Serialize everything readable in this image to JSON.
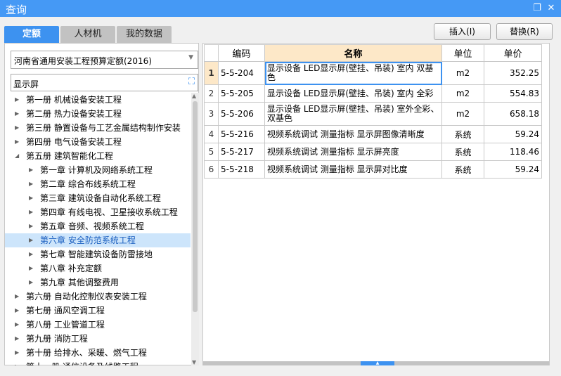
{
  "window": {
    "title": "查询",
    "restore_icon": "restore-icon",
    "close_icon": "close-icon"
  },
  "tabs": [
    {
      "label": "定额",
      "active": true
    },
    {
      "label": "人材机"
    },
    {
      "label": "我的数据"
    }
  ],
  "buttons": {
    "insert": "插入(I)",
    "replace": "替换(R)"
  },
  "quota_select": {
    "value": "河南省通用安装工程预算定额(2016)"
  },
  "search": {
    "value": "显示屏"
  },
  "tree": [
    {
      "label": "第一册  机械设备安装工程",
      "level": 0,
      "expanded": false
    },
    {
      "label": "第二册  热力设备安装工程",
      "level": 0,
      "expanded": false
    },
    {
      "label": "第三册  静置设备与工艺金属结构制作安装",
      "level": 0,
      "expanded": false
    },
    {
      "label": "第四册  电气设备安装工程",
      "level": 0,
      "expanded": false
    },
    {
      "label": "第五册  建筑智能化工程",
      "level": 0,
      "expanded": true
    },
    {
      "label": "第一章  计算机及网络系统工程",
      "level": 1
    },
    {
      "label": "第二章  综合布线系统工程",
      "level": 1
    },
    {
      "label": "第三章  建筑设备自动化系统工程",
      "level": 1
    },
    {
      "label": "第四章  有线电视、卫星接收系统工程",
      "level": 1
    },
    {
      "label": "第五章  音频、视频系统工程",
      "level": 1
    },
    {
      "label": "第六章  安全防范系统工程",
      "level": 1,
      "selected": true
    },
    {
      "label": "第七章  智能建筑设备防雷接地",
      "level": 1
    },
    {
      "label": "第八章  补充定额",
      "level": 1
    },
    {
      "label": "第九章  其他调整费用",
      "level": 1
    },
    {
      "label": "第六册  自动化控制仪表安装工程",
      "level": 0
    },
    {
      "label": "第七册  通风空调工程",
      "level": 0
    },
    {
      "label": "第八册  工业管道工程",
      "level": 0
    },
    {
      "label": "第九册  消防工程",
      "level": 0
    },
    {
      "label": "第十册  给排水、采暖、燃气工程",
      "level": 0
    },
    {
      "label": "第十一册  通信设备及线路工程",
      "level": 0
    }
  ],
  "table": {
    "headers": [
      "",
      "编码",
      "名称",
      "单位",
      "单价"
    ],
    "rows": [
      {
        "no": "1",
        "code": "5-5-204",
        "name": "显示设备 LED显示屏(壁挂、吊装) 室内 双基色",
        "unit": "m2",
        "price": "352.25",
        "selected": true
      },
      {
        "no": "2",
        "code": "5-5-205",
        "name": "显示设备 LED显示屏(壁挂、吊装) 室内 全彩",
        "unit": "m2",
        "price": "554.83"
      },
      {
        "no": "3",
        "code": "5-5-206",
        "name": "显示设备 LED显示屏(壁挂、吊装) 室外全彩、双基色",
        "unit": "m2",
        "price": "658.18"
      },
      {
        "no": "4",
        "code": "5-5-216",
        "name": "视频系统调试 测量指标 显示屏图像清晰度",
        "unit": "系统",
        "price": "59.24"
      },
      {
        "no": "5",
        "code": "5-5-217",
        "name": "视频系统调试 测量指标 显示屏亮度",
        "unit": "系统",
        "price": "118.46"
      },
      {
        "no": "6",
        "code": "5-5-218",
        "name": "视频系统调试 测量指标 显示屏对比度",
        "unit": "系统",
        "price": "59.24"
      }
    ]
  },
  "colors": {
    "accent": "#3d92f0",
    "title_bar": "#4599f5",
    "header_highlight": "#fde8c8"
  }
}
